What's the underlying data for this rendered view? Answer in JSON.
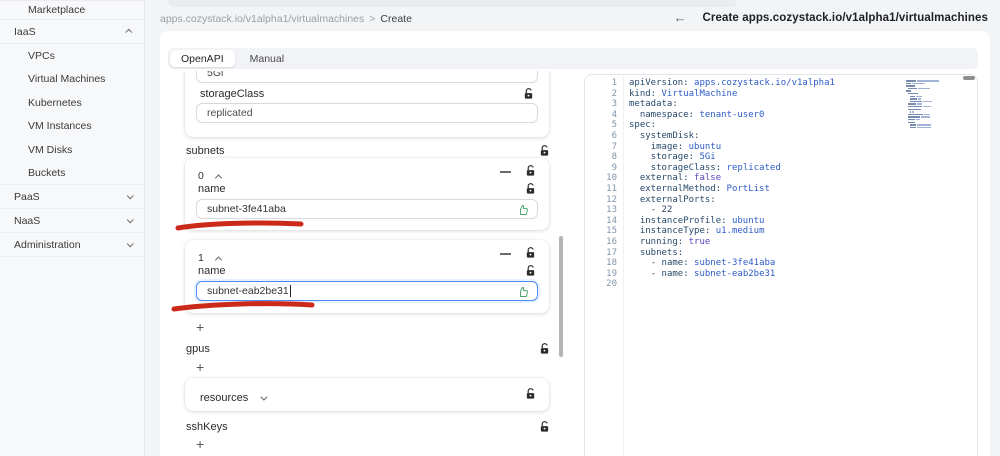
{
  "sidebar": {
    "items": [
      {
        "label": "Marketplace",
        "level": 1,
        "chevron": null,
        "group_end": true
      },
      {
        "label": "IaaS",
        "level": 0,
        "chevron": "up"
      },
      {
        "label": "VPCs",
        "level": 1,
        "chevron": null
      },
      {
        "label": "Virtual Machines",
        "level": 1,
        "chevron": null
      },
      {
        "label": "Kubernetes",
        "level": 1,
        "chevron": null
      },
      {
        "label": "VM Instances",
        "level": 1,
        "chevron": null
      },
      {
        "label": "VM Disks",
        "level": 1,
        "chevron": null
      },
      {
        "label": "Buckets",
        "level": 1,
        "chevron": null,
        "group_end": true
      },
      {
        "label": "PaaS",
        "level": 0,
        "chevron": "down"
      },
      {
        "label": "NaaS",
        "level": 0,
        "chevron": "down"
      },
      {
        "label": "Administration",
        "level": 0,
        "chevron": "down"
      }
    ]
  },
  "breadcrumb": {
    "path": "apps.cozystack.io/v1alpha1/virtualmachines",
    "separator": ">",
    "current": "Create"
  },
  "header": {
    "back_icon": "←",
    "title": "Create apps.cozystack.io/v1alpha1/virtualmachines"
  },
  "tabs": {
    "openapi": "OpenAPI",
    "manual": "Manual"
  },
  "form": {
    "top_field": {
      "value": "5Gi"
    },
    "storage_class": {
      "label": "storageClass",
      "value": "replicated"
    },
    "subnets": {
      "label": "subnets",
      "items": [
        {
          "index": "0",
          "name_label": "name",
          "value": "subnet-3fe41aba"
        },
        {
          "index": "1",
          "name_label": "name",
          "value": "subnet-eab2be31"
        }
      ],
      "add_label": "+"
    },
    "gpus": {
      "label": "gpus",
      "add_label": "+"
    },
    "resources": {
      "label": "resources"
    },
    "ssh_keys": {
      "label": "sshKeys",
      "add_label": "+"
    }
  },
  "annotations": {
    "color": "#cb2a1b"
  },
  "editor": {
    "lines": [
      {
        "sp": 0,
        "key": "apiVersion",
        "value": "apps.cozystack.io/v1alpha1",
        "vtype": "str"
      },
      {
        "sp": 0,
        "key": "kind",
        "value": "VirtualMachine",
        "vtype": "str"
      },
      {
        "sp": 0,
        "key": "metadata",
        "value": null
      },
      {
        "sp": 2,
        "key": "namespace",
        "value": "tenant-user0",
        "vtype": "str"
      },
      {
        "sp": 0,
        "key": "spec",
        "value": null
      },
      {
        "sp": 2,
        "key": "systemDisk",
        "value": null
      },
      {
        "sp": 4,
        "key": "image",
        "value": "ubuntu",
        "vtype": "str"
      },
      {
        "sp": 4,
        "key": "storage",
        "value": "5Gi",
        "vtype": "str"
      },
      {
        "sp": 4,
        "key": "storageClass",
        "value": "replicated",
        "vtype": "str"
      },
      {
        "sp": 2,
        "key": "external",
        "value": "false",
        "vtype": "bool"
      },
      {
        "sp": 2,
        "key": "externalMethod",
        "value": "PortList",
        "vtype": "str"
      },
      {
        "sp": 2,
        "key": "externalPorts",
        "value": null
      },
      {
        "sp": 4,
        "dash": true,
        "value": "22",
        "vtype": "num"
      },
      {
        "sp": 2,
        "key": "instanceProfile",
        "value": "ubuntu",
        "vtype": "str"
      },
      {
        "sp": 2,
        "key": "instanceType",
        "value": "u1.medium",
        "vtype": "str"
      },
      {
        "sp": 2,
        "key": "running",
        "value": "true",
        "vtype": "bool"
      },
      {
        "sp": 2,
        "key": "subnets",
        "value": null
      },
      {
        "sp": 4,
        "dash": true,
        "key": "name",
        "value": "subnet-3fe41aba",
        "vtype": "str"
      },
      {
        "sp": 4,
        "dash": true,
        "key": "name",
        "value": "subnet-eab2be31",
        "vtype": "str"
      },
      {
        "sp": 0
      }
    ]
  }
}
